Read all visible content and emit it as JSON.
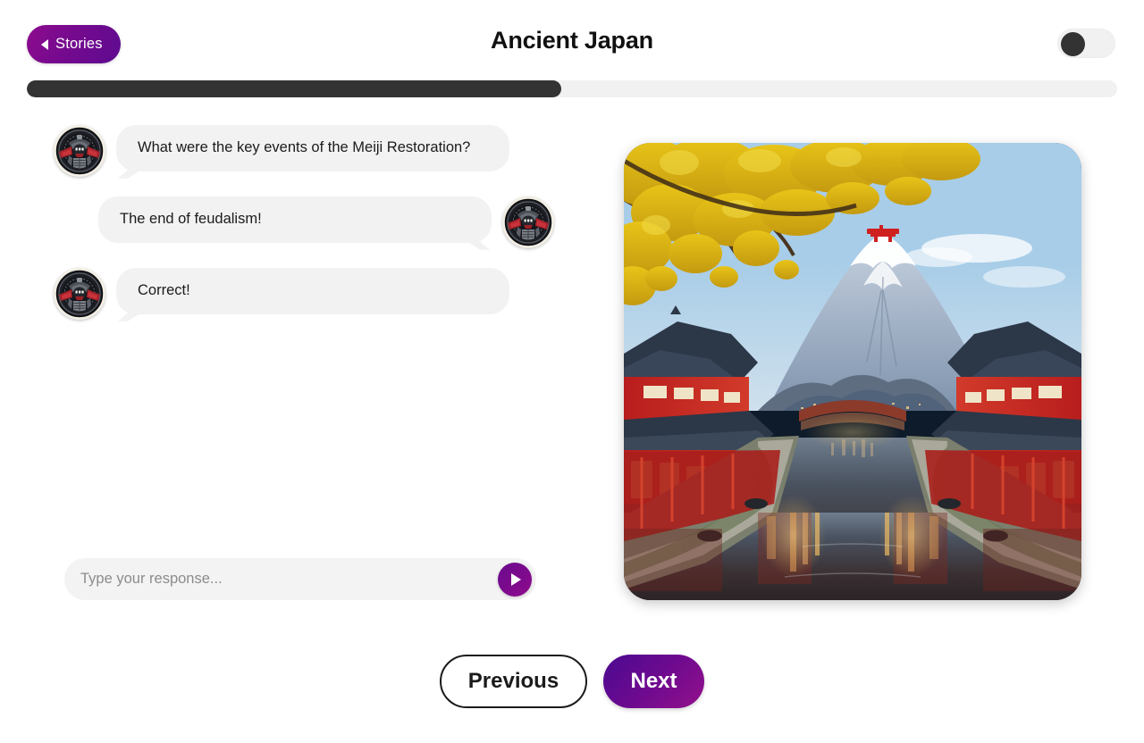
{
  "header": {
    "back_button_label": "Stories",
    "back_icon": "caret-left-icon",
    "title": "Ancient Japan",
    "toggle": {
      "name": "mode-toggle",
      "state": "off"
    }
  },
  "progress": {
    "percent": 49,
    "percent_label": "49%"
  },
  "chat": {
    "avatar_icon": "samurai-emblem-avatar",
    "messages": [
      {
        "sender": "bot",
        "text": "What were the key events of the Meiji Restoration?"
      },
      {
        "sender": "user",
        "text": "The end of feudalism!"
      },
      {
        "sender": "bot",
        "text": "Correct!"
      }
    ]
  },
  "composer": {
    "placeholder": "Type your response...",
    "value": "",
    "send_icon": "send-play-icon"
  },
  "scene": {
    "alt": "Mount Fuji behind red Japanese temple buildings along a canal at dusk with golden ginkgo leaves"
  },
  "footer": {
    "previous_label": "Previous",
    "next_label": "Next"
  },
  "colors": {
    "accent_purple": "#7a0a8e",
    "accent_magenta": "#93108b",
    "progress_fill": "#333333",
    "bubble_gray": "#f2f2f2",
    "track_gray": "#f1f1f1"
  }
}
